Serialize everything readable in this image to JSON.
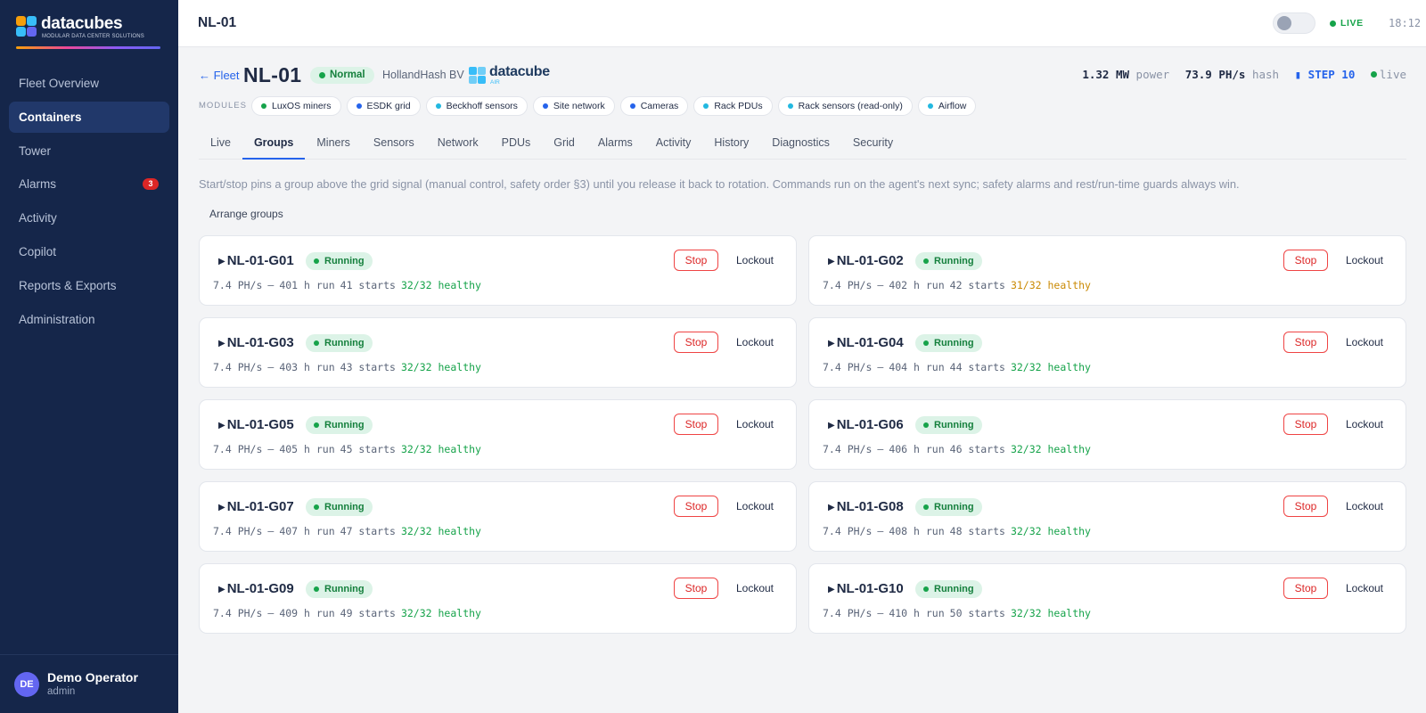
{
  "sidebar": {
    "brand_name": "datacubes",
    "brand_tagline": "MODULAR DATA CENTER SOLUTIONS",
    "items": [
      {
        "label": "Fleet Overview",
        "active": false
      },
      {
        "label": "Containers",
        "active": true
      },
      {
        "label": "Tower",
        "active": false
      },
      {
        "label": "Alarms",
        "active": false,
        "badge": "3"
      },
      {
        "label": "Activity",
        "active": false
      },
      {
        "label": "Copilot",
        "active": false
      },
      {
        "label": "Reports & Exports",
        "active": false
      },
      {
        "label": "Administration",
        "active": false
      }
    ],
    "user": {
      "initials": "DE",
      "name": "Demo Operator",
      "role": "admin"
    }
  },
  "topbar": {
    "title": "NL-01",
    "live_label": "LIVE",
    "time": "18:12"
  },
  "header": {
    "back_label": "← Fleet",
    "title": "NL-01",
    "status": "Normal",
    "owner": "HollandHash BV",
    "partner_brand": "datacube",
    "partner_tag": "AIR",
    "power_value": "1.32 MW",
    "power_label": "power",
    "hash_value": "73.9 PH/s",
    "hash_label": "hash",
    "step": "▮ STEP 10",
    "live": "live"
  },
  "modules": {
    "label": "MODULES",
    "items": [
      {
        "label": "LuxOS miners",
        "color": "#16a34a"
      },
      {
        "label": "ESDK grid",
        "color": "#2563eb"
      },
      {
        "label": "Beckhoff sensors",
        "color": "#22b8e0"
      },
      {
        "label": "Site network",
        "color": "#2563eb"
      },
      {
        "label": "Cameras",
        "color": "#2563eb"
      },
      {
        "label": "Rack PDUs",
        "color": "#22b8e0"
      },
      {
        "label": "Rack sensors (read-only)",
        "color": "#22b8e0"
      },
      {
        "label": "Airflow",
        "color": "#22b8e0"
      }
    ]
  },
  "tabs": [
    {
      "label": "Live",
      "active": false
    },
    {
      "label": "Groups",
      "active": true
    },
    {
      "label": "Miners",
      "active": false
    },
    {
      "label": "Sensors",
      "active": false
    },
    {
      "label": "Network",
      "active": false
    },
    {
      "label": "PDUs",
      "active": false
    },
    {
      "label": "Grid",
      "active": false
    },
    {
      "label": "Alarms",
      "active": false
    },
    {
      "label": "Activity",
      "active": false
    },
    {
      "label": "History",
      "active": false
    },
    {
      "label": "Diagnostics",
      "active": false
    },
    {
      "label": "Security",
      "active": false
    }
  ],
  "notice": "Start/stop pins a group above the grid signal (manual control, safety order §3) until you release it back to rotation. Commands run on the agent's next sync; safety alarms and rest/run-time guards always win.",
  "arrange_label": "Arrange groups",
  "groups": [
    {
      "name": "NL-01-G01",
      "status": "Running",
      "hash": "7.4 PH/s",
      "dash": "—",
      "run": "401 h run",
      "starts": "41 starts",
      "healthy": "32/32 healthy",
      "warn": false
    },
    {
      "name": "NL-01-G02",
      "status": "Running",
      "hash": "7.4 PH/s",
      "dash": "—",
      "run": "402 h run",
      "starts": "42 starts",
      "healthy": "31/32 healthy",
      "warn": true
    },
    {
      "name": "NL-01-G03",
      "status": "Running",
      "hash": "7.4 PH/s",
      "dash": "—",
      "run": "403 h run",
      "starts": "43 starts",
      "healthy": "32/32 healthy",
      "warn": false
    },
    {
      "name": "NL-01-G04",
      "status": "Running",
      "hash": "7.4 PH/s",
      "dash": "—",
      "run": "404 h run",
      "starts": "44 starts",
      "healthy": "32/32 healthy",
      "warn": false
    },
    {
      "name": "NL-01-G05",
      "status": "Running",
      "hash": "7.4 PH/s",
      "dash": "—",
      "run": "405 h run",
      "starts": "45 starts",
      "healthy": "32/32 healthy",
      "warn": false
    },
    {
      "name": "NL-01-G06",
      "status": "Running",
      "hash": "7.4 PH/s",
      "dash": "—",
      "run": "406 h run",
      "starts": "46 starts",
      "healthy": "32/32 healthy",
      "warn": false
    },
    {
      "name": "NL-01-G07",
      "status": "Running",
      "hash": "7.4 PH/s",
      "dash": "—",
      "run": "407 h run",
      "starts": "47 starts",
      "healthy": "32/32 healthy",
      "warn": false
    },
    {
      "name": "NL-01-G08",
      "status": "Running",
      "hash": "7.4 PH/s",
      "dash": "—",
      "run": "408 h run",
      "starts": "48 starts",
      "healthy": "32/32 healthy",
      "warn": false
    },
    {
      "name": "NL-01-G09",
      "status": "Running",
      "hash": "7.4 PH/s",
      "dash": "—",
      "run": "409 h run",
      "starts": "49 starts",
      "healthy": "32/32 healthy",
      "warn": false
    },
    {
      "name": "NL-01-G10",
      "status": "Running",
      "hash": "7.4 PH/s",
      "dash": "—",
      "run": "410 h run",
      "starts": "50 starts",
      "healthy": "32/32 healthy",
      "warn": false
    }
  ],
  "group_actions": {
    "stop": "Stop",
    "lockout": "Lockout"
  }
}
